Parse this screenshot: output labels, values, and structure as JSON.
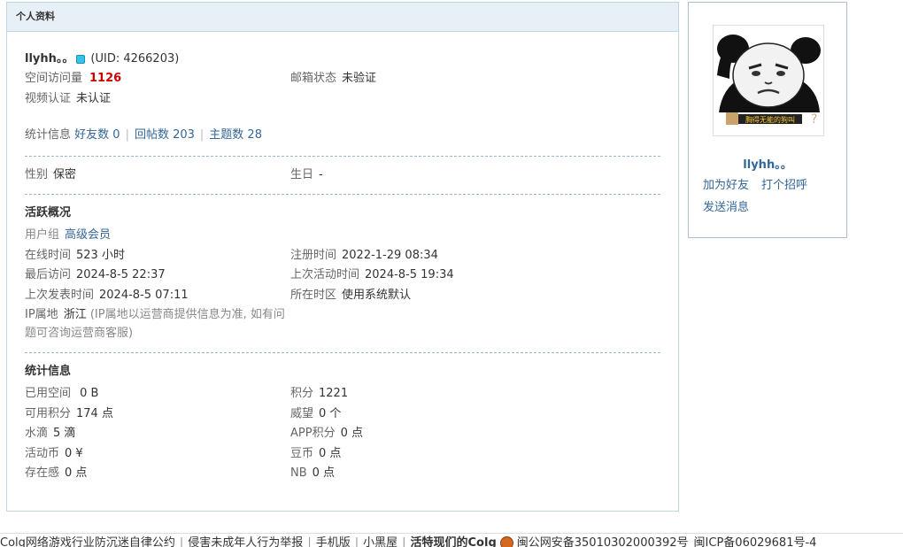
{
  "panel": {
    "title": "个人资料"
  },
  "profile": {
    "username": "llyhh。。",
    "uid": "(UID: 4266203)",
    "space_views_label": "空间访问量",
    "space_views": "1126",
    "email_label": "邮箱状态",
    "email_value": "未验证",
    "video_label": "视频认证",
    "video_value": "未认证"
  },
  "stats_line": {
    "label": "统计信息",
    "friends": "好友数 0",
    "replies": "回帖数 203",
    "topics": "主题数 28"
  },
  "basic": {
    "gender_label": "性别",
    "gender_value": "保密",
    "birthday_label": "生日",
    "birthday_value": "-"
  },
  "activity": {
    "title": "活跃概况",
    "group_label": "用户组",
    "group_value": "高级会员",
    "online_label": "在线时间",
    "online_value": "523 小时",
    "register_label": "注册时间",
    "register_value": "2022-1-29 08:34",
    "last_visit_label": "最后访问",
    "last_visit_value": "2024-8-5 22:37",
    "last_active_label": "上次活动时间",
    "last_active_value": "2024-8-5 19:34",
    "last_post_label": "上次发表时间",
    "last_post_value": "2024-8-5 07:11",
    "timezone_label": "所在时区",
    "timezone_value": "使用系统默认",
    "ip_label": "IP属地",
    "ip_value": "浙江",
    "ip_note": "(IP属地以运营商提供信息为准, 如有问题可咨询运营商客服)"
  },
  "statistics": {
    "title": "统计信息",
    "items": [
      {
        "label": "已用空间",
        "value": " 0 B"
      },
      {
        "label": "积分",
        "value": "1221"
      },
      {
        "label": "可用积分",
        "value": "174 点"
      },
      {
        "label": "威望",
        "value": "0 个"
      },
      {
        "label": "水滴",
        "value": "5 滴"
      },
      {
        "label": "APP积分",
        "value": "0 点"
      },
      {
        "label": "活动币",
        "value": "0 ¥"
      },
      {
        "label": "豆币",
        "value": "0 点"
      },
      {
        "label": "存在感",
        "value": "0 点"
      },
      {
        "label": "NB",
        "value": "0 点"
      }
    ]
  },
  "sidebar": {
    "avatar_caption": "胸得无能的狗叫",
    "name": "llyhh。。",
    "add_friend": "加为好友",
    "greet": "打个招呼",
    "send_message": "发送消息"
  },
  "footer": {
    "items": [
      "Colg网络游戏行业防沉迷自律公约",
      "侵害未成年人行为举报",
      "手机版",
      "小黑屋",
      "活特现们的Colg",
      "闽公网安备35010302000392号",
      "闽ICP备06029681号-4"
    ]
  },
  "colors": {
    "accent": "#336699",
    "highlight": "#cc0000",
    "header_bg": "#e8f0f7"
  }
}
